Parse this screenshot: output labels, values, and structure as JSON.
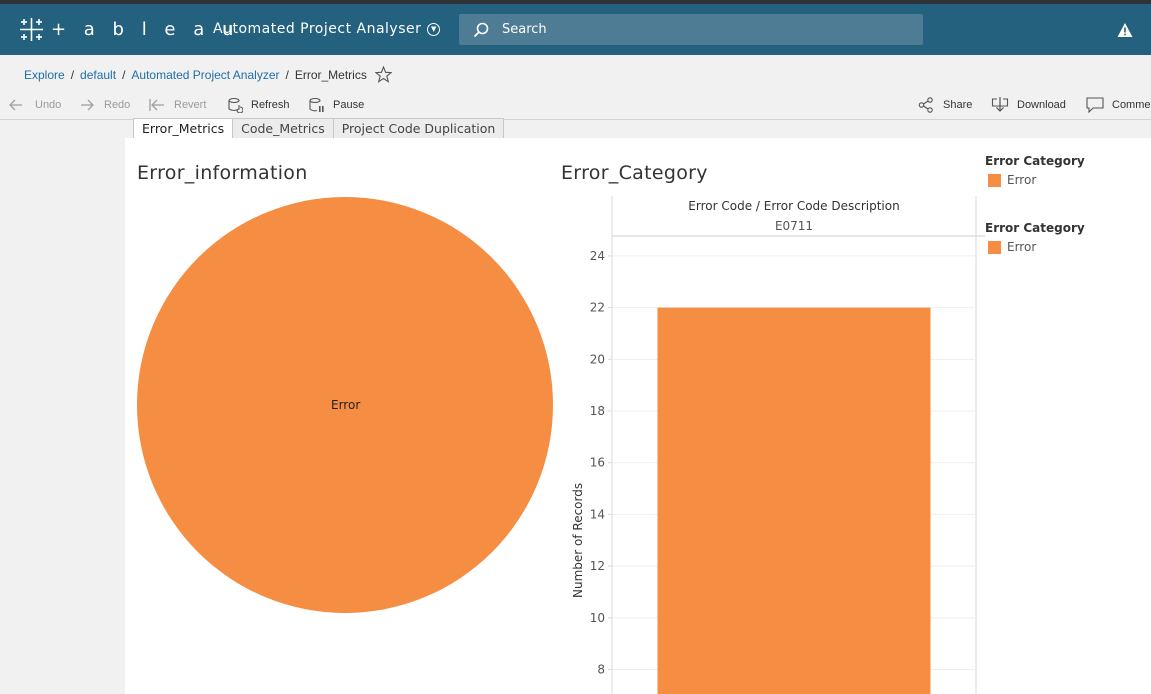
{
  "header": {
    "brand": "+ a b l e a u",
    "app_title": "Automated Project Analyser",
    "search_placeholder": "Search"
  },
  "breadcrumb": {
    "items": [
      "Explore",
      "default",
      "Automated Project Analyzer"
    ],
    "current": "Error_Metrics"
  },
  "toolbar": {
    "undo": "Undo",
    "redo": "Redo",
    "revert": "Revert",
    "refresh": "Refresh",
    "pause": "Pause",
    "share": "Share",
    "download": "Download",
    "comments": "Comme"
  },
  "tabs": [
    {
      "label": "Error_Metrics",
      "active": true
    },
    {
      "label": "Code_Metrics",
      "active": false
    },
    {
      "label": "Project Code Duplication",
      "active": false
    }
  ],
  "dashboard": {
    "pie_title": "Error_information",
    "bar_title": "Error_Category",
    "legends": [
      {
        "title": "Error Category",
        "item": "Error"
      },
      {
        "title": "Error Category",
        "item": "Error"
      }
    ]
  },
  "colors": {
    "accent": "#f58d42",
    "header_bg": "#23617f",
    "link": "#1f6ea4"
  },
  "chart_data": [
    {
      "type": "pie",
      "title": "Error_information",
      "slices": [
        {
          "label": "Error",
          "value": 1.0
        }
      ]
    },
    {
      "type": "bar",
      "title": "Error_Category",
      "header": "Error Code  /  Error Code Description",
      "categories": [
        "E0711"
      ],
      "values": [
        22
      ],
      "ylabel": "Number of Records",
      "yticks": [
        24,
        22,
        20,
        18,
        16,
        14,
        12,
        10,
        8
      ],
      "ylim": [
        7,
        24.5
      ],
      "grid": true
    }
  ]
}
